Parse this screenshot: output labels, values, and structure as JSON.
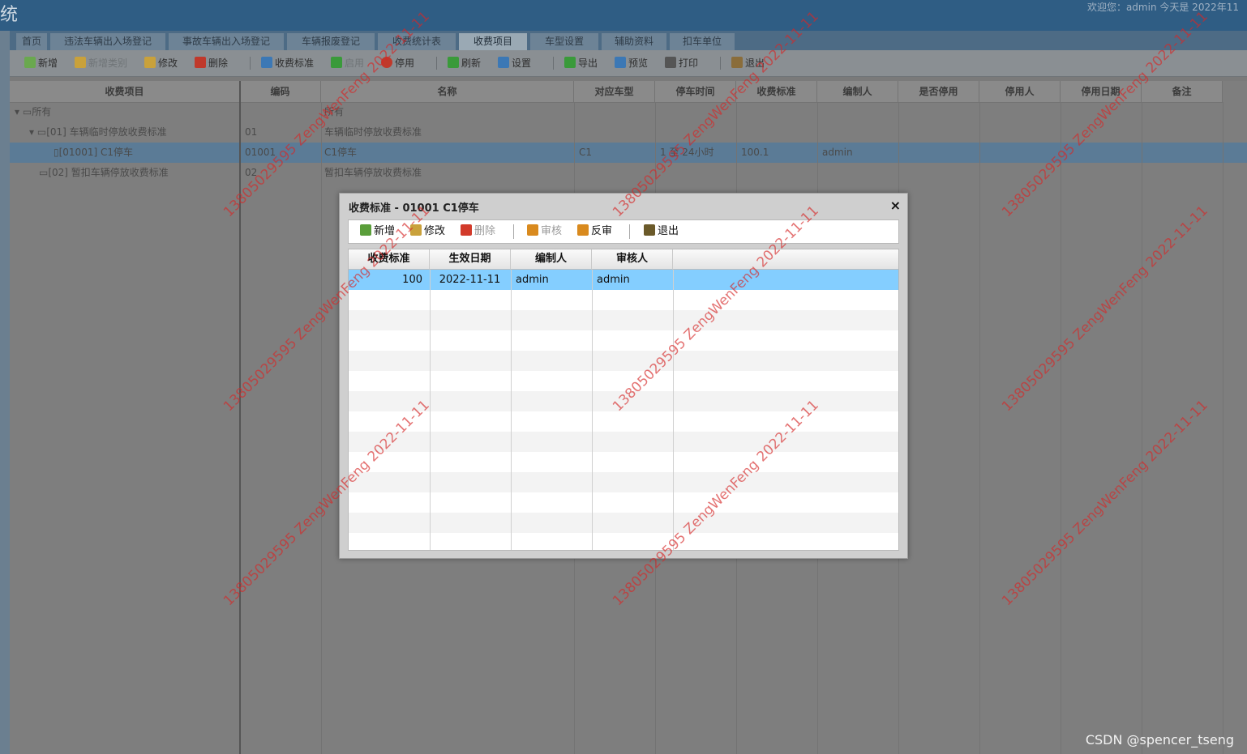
{
  "app": {
    "title_fragment": "统",
    "user_info": "欢迎您：admin    今天是 2022年11"
  },
  "tabs": [
    {
      "label": "首页"
    },
    {
      "label": "违法车辆出入场登记"
    },
    {
      "label": "事故车辆出入场登记"
    },
    {
      "label": "车辆报废登记"
    },
    {
      "label": "收费统计表"
    },
    {
      "label": "收费项目"
    },
    {
      "label": "车型设置"
    },
    {
      "label": "辅助资料"
    },
    {
      "label": "扣车单位"
    }
  ],
  "toolbar": {
    "items": [
      {
        "label": "新增",
        "icon": "add-icon",
        "color": "#6aa84f"
      },
      {
        "label": "新增类别",
        "icon": "add-category-icon",
        "color": "#c9a13b"
      },
      {
        "label": "修改",
        "icon": "edit-icon",
        "color": "#c9a13b"
      },
      {
        "label": "删除",
        "icon": "delete-icon",
        "color": "#c0392b"
      },
      {
        "label": "收费标准",
        "icon": "fee-standard-icon",
        "color": "#3c78b5"
      },
      {
        "label": "启用",
        "icon": "enable-icon",
        "color": "#3a9a3a"
      },
      {
        "label": "停用",
        "icon": "disable-icon",
        "color": "#c0392b"
      },
      {
        "label": "刷新",
        "icon": "refresh-icon",
        "color": "#3a9a3a"
      },
      {
        "label": "设置",
        "icon": "settings-icon",
        "color": "#3c78b5"
      },
      {
        "label": "导出",
        "icon": "export-icon",
        "color": "#3a9a3a"
      },
      {
        "label": "预览",
        "icon": "preview-icon",
        "color": "#3c78b5"
      },
      {
        "label": "打印",
        "icon": "print-icon",
        "color": "#555555"
      },
      {
        "label": "退出",
        "icon": "exit-icon",
        "color": "#8a6d3b"
      }
    ]
  },
  "grid": {
    "headers": [
      "收费项目",
      "编码",
      "名称",
      "对应车型",
      "停车时间",
      "收费标准",
      "编制人",
      "是否停用",
      "停用人",
      "停用日期",
      "备注"
    ],
    "rows": [
      {
        "tree": "所有",
        "code": "",
        "name": "所有",
        "car_type": "",
        "time": "",
        "fee": "",
        "maker": ""
      },
      {
        "tree": "[01] 车辆临时停放收费标准",
        "code": "01",
        "name": "车辆临时停放收费标准",
        "car_type": "",
        "time": "",
        "fee": "",
        "maker": ""
      },
      {
        "tree": "[01001] C1停车",
        "code": "01001",
        "name": "C1停车",
        "car_type": "C1",
        "time": "1 至 24小时",
        "fee": "100.1",
        "maker": "admin"
      },
      {
        "tree": "[02] 暂扣车辆停放收费标准",
        "code": "02",
        "name": "暂扣车辆停放收费标准",
        "car_type": "",
        "time": "",
        "fee": "",
        "maker": ""
      }
    ]
  },
  "dialog": {
    "title": "收费标准 - 01001 C1停车",
    "close": "×",
    "toolbar": [
      {
        "label": "新增",
        "icon": "add-icon",
        "color": "#5a9e3a",
        "disabled": false
      },
      {
        "label": "修改",
        "icon": "edit-icon",
        "color": "#c9a13b",
        "disabled": false
      },
      {
        "label": "删除",
        "icon": "delete-icon",
        "color": "#d23a2a",
        "disabled": true
      },
      {
        "label": "审核",
        "icon": "approve-icon",
        "color": "#d98a1e",
        "disabled": true
      },
      {
        "label": "反审",
        "icon": "unapprove-icon",
        "color": "#d98a1e",
        "disabled": false
      },
      {
        "label": "退出",
        "icon": "exit-icon",
        "color": "#6b5a2a",
        "disabled": false
      }
    ],
    "headers": [
      "收费标准",
      "生效日期",
      "编制人",
      "审核人"
    ],
    "rows": [
      {
        "fee": "100",
        "date": "2022-11-11",
        "maker": "admin",
        "approver": "admin"
      }
    ]
  },
  "watermark": {
    "text": "13805029595 ZengWenFeng 2022-11-11"
  },
  "credit": "CSDN @spencer_tseng"
}
